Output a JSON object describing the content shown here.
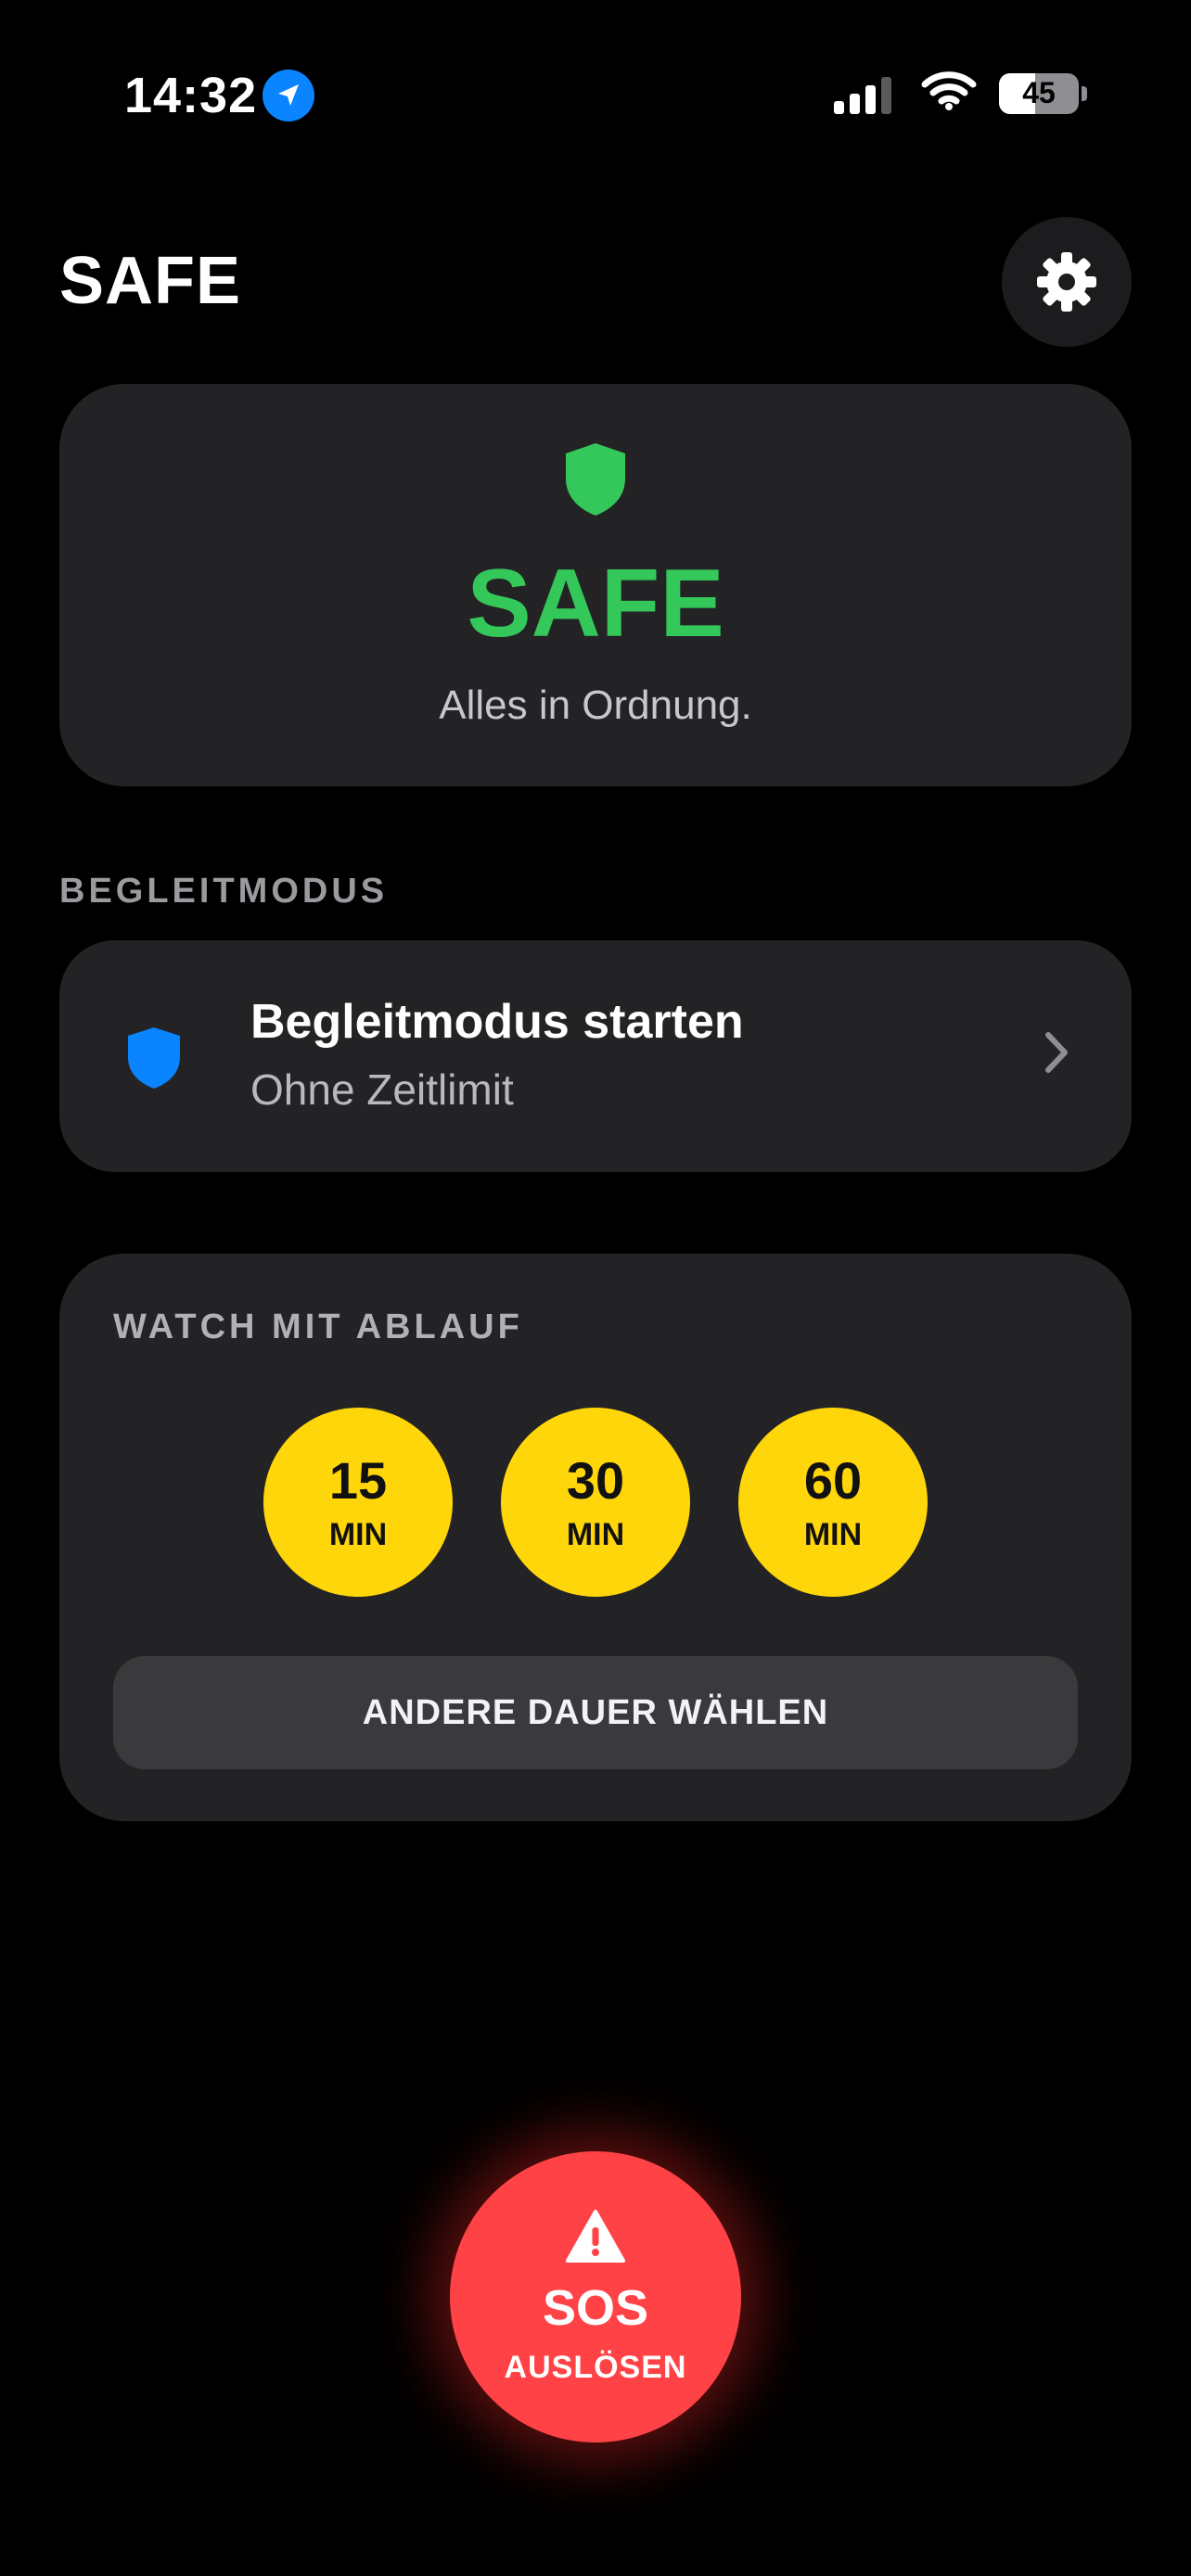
{
  "status_bar": {
    "time": "14:32",
    "battery_level": "45",
    "battery_fraction": 0.45,
    "location_icon": "location-arrow-icon",
    "signal_icon": "cellular-signal-icon",
    "wifi_icon": "wifi-icon"
  },
  "header": {
    "title": "SAFE",
    "settings_icon": "gear-icon"
  },
  "status_card": {
    "icon": "shield-icon",
    "title": "SAFE",
    "subtitle": "Alles in Ordnung.",
    "color": "#34c759"
  },
  "companion_section": {
    "label": "BEGLEITMODUS",
    "item": {
      "icon": "shield-icon",
      "title": "Begleitmodus starten",
      "subtitle": "Ohne Zeitlimit",
      "chevron": "chevron-right-icon",
      "icon_color": "#0a84ff"
    }
  },
  "watch_section": {
    "label": "WATCH MIT ABLAUF",
    "durations": [
      {
        "value": "15",
        "unit": "MIN"
      },
      {
        "value": "30",
        "unit": "MIN"
      },
      {
        "value": "60",
        "unit": "MIN"
      }
    ],
    "other_label": "ANDERE DAUER WÄHLEN",
    "accent_color": "#ffd60a"
  },
  "sos": {
    "icon": "warning-triangle-icon",
    "title": "SOS",
    "subtitle": "AUSLÖSEN",
    "color": "#ff4245"
  }
}
